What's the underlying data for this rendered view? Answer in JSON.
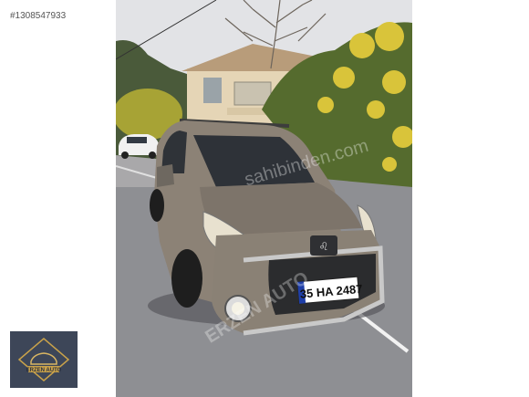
{
  "listing": {
    "id_text": "#1308547933"
  },
  "vehicle": {
    "brand_logo": "peugeot-lion-icon",
    "plate": "35 HA 2487",
    "body_color": "#8c8276"
  },
  "watermark": {
    "text_windshield": "sahibinden.com",
    "text_bumper": "ERZEN AUTO"
  },
  "dealer": {
    "logo_text": "ERZEN AUTO"
  },
  "colors": {
    "sky": "#e4e4e6",
    "road": "#8f8f93",
    "foliage": "#6b7d3a",
    "flowers": "#d9c43a",
    "house": "#e7d6b8"
  }
}
